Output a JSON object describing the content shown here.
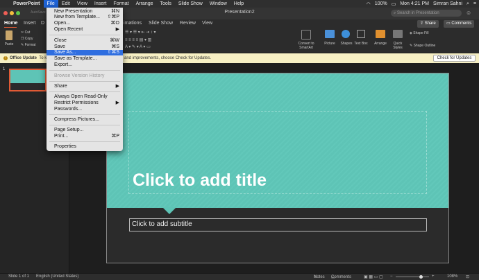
{
  "menubar": {
    "app": "PowerPoint",
    "items": [
      "File",
      "Edit",
      "View",
      "Insert",
      "Format",
      "Arrange",
      "Tools",
      "Slide Show",
      "Window",
      "Help"
    ],
    "battery": "100%",
    "clock": "Mon 4:21 PM",
    "user": "Simran Sahni"
  },
  "window": {
    "title": "Presentation2",
    "autosave": "AutoSave",
    "search_placeholder": "Search in Presentation"
  },
  "ribbon_tabs": {
    "home": "Home",
    "insert": "Insert",
    "d": "D",
    "animations": "imations",
    "slideshow": "Slide Show",
    "review": "Review",
    "view": "View",
    "share": "Share",
    "comments": "Comments"
  },
  "ribbon": {
    "paste": "Paste",
    "cut": "Cut",
    "copy": "Copy",
    "format": "Format",
    "convert_smartart": "Convert to SmartArt",
    "picture": "Picture",
    "shapes": "Shapes",
    "textbox": "Text Box",
    "arrange": "Arrange",
    "quick_styles": "Quick Styles",
    "shape_fill": "Shape Fill",
    "shape_outline": "Shape Outline"
  },
  "update_bar": {
    "label": "Office Update",
    "to": "To ke",
    "message": "and improvements, choose Check for Updates.",
    "button": "Check for Updates"
  },
  "thumbnails": [
    {
      "number": "1"
    }
  ],
  "slide": {
    "title_placeholder": "Click to add title",
    "subtitle_placeholder": "Click to add subtitle"
  },
  "file_menu": {
    "items": [
      {
        "label": "New Presentation",
        "shortcut": "⌘N"
      },
      {
        "label": "New from Template...",
        "shortcut": "⇧⌘P"
      },
      {
        "label": "Open...",
        "shortcut": "⌘O"
      },
      {
        "label": "Open Recent",
        "shortcut": "▶"
      },
      {
        "label": "Close",
        "shortcut": "⌘W"
      },
      {
        "label": "Save",
        "shortcut": "⌘S"
      },
      {
        "label": "Save As...",
        "shortcut": "⇧⌘S"
      },
      {
        "label": "Save as Template...",
        "shortcut": ""
      },
      {
        "label": "Export...",
        "shortcut": ""
      },
      {
        "label": "Browse Version History",
        "shortcut": ""
      },
      {
        "label": "Share",
        "shortcut": "▶"
      },
      {
        "label": "Always Open Read-Only",
        "shortcut": ""
      },
      {
        "label": "Restrict Permissions",
        "shortcut": "▶"
      },
      {
        "label": "Passwords...",
        "shortcut": ""
      },
      {
        "label": "Compress Pictures...",
        "shortcut": ""
      },
      {
        "label": "Page Setup...",
        "shortcut": ""
      },
      {
        "label": "Print...",
        "shortcut": "⌘P"
      },
      {
        "label": "Properties",
        "shortcut": ""
      }
    ],
    "highlighted": "Save As..."
  },
  "status_bar": {
    "slide_counter": "Slide 1 of 1",
    "language": "English (United States)",
    "notes": "Notes",
    "comments": "Comments",
    "zoom": "108%"
  },
  "colors": {
    "teal": "#5ec4b6",
    "accent": "#e05a35",
    "menu_highlight": "#2f6ee0"
  }
}
